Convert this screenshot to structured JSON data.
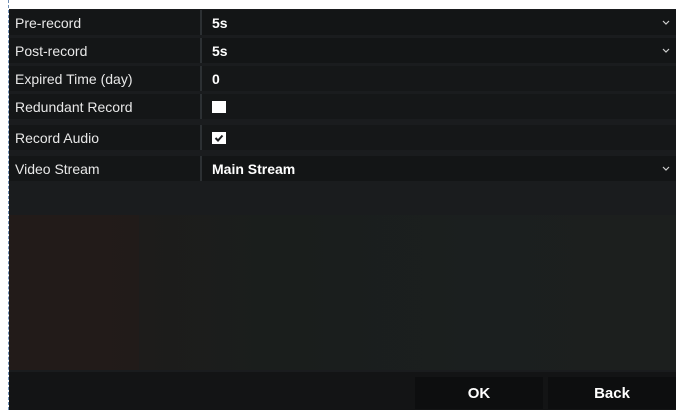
{
  "settings": {
    "pre_record": {
      "label": "Pre-record",
      "value": "5s"
    },
    "post_record": {
      "label": "Post-record",
      "value": "5s"
    },
    "expired_time": {
      "label": "Expired Time (day)",
      "value": "0"
    },
    "redundant_record": {
      "label": "Redundant Record",
      "checked": false
    },
    "record_audio": {
      "label": "Record Audio",
      "checked": true
    },
    "video_stream": {
      "label": "Video Stream",
      "value": "Main Stream"
    }
  },
  "buttons": {
    "ok_label": "OK",
    "back_label": "Back"
  },
  "icons": {
    "dropdown": "chevron-down-icon",
    "check": "checkmark-icon"
  },
  "colors": {
    "background": "#1a1c1e",
    "text": "#ffffff",
    "checkbox": "#ffffff"
  }
}
